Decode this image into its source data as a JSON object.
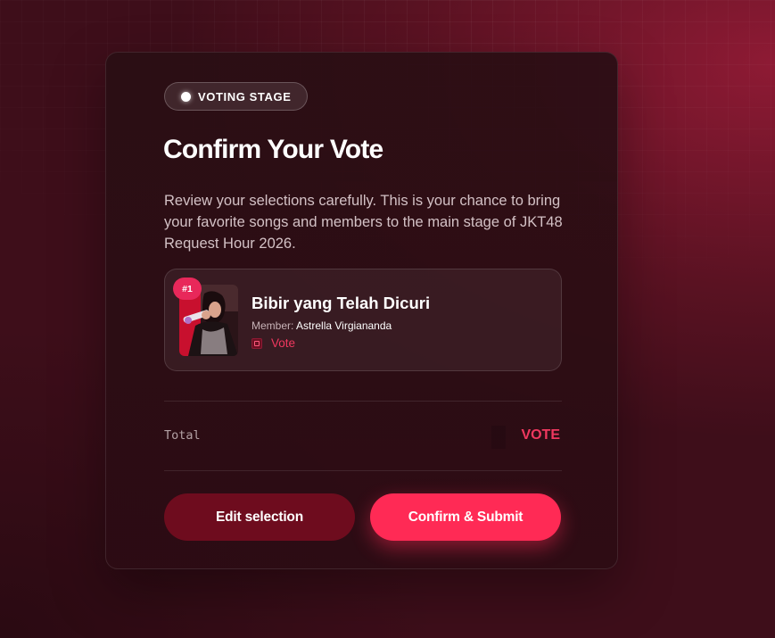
{
  "header": {
    "badge_label": "VOTING STAGE",
    "title": "Confirm Your Vote",
    "description": "Review your selections carefully. This is your chance to bring your favorite songs and members to the main stage of JKT48 Request Hour 2026."
  },
  "selection": {
    "rank": "#1",
    "song_title": "Bibir yang Telah Dicuri",
    "member_prefix": "Member:",
    "member_name": "Astrella Virgiananda",
    "vote_label": "Vote",
    "vote_icon": "vote-icon"
  },
  "summary": {
    "total_label": "Total",
    "total_value": "VOTE"
  },
  "actions": {
    "edit_label": "Edit selection",
    "confirm_label": "Confirm & Submit"
  },
  "colors": {
    "accent": "#ff2a55",
    "accent_text": "#f0385f",
    "edit_button": "#6e0c1e",
    "background": "#3e0e1a"
  }
}
